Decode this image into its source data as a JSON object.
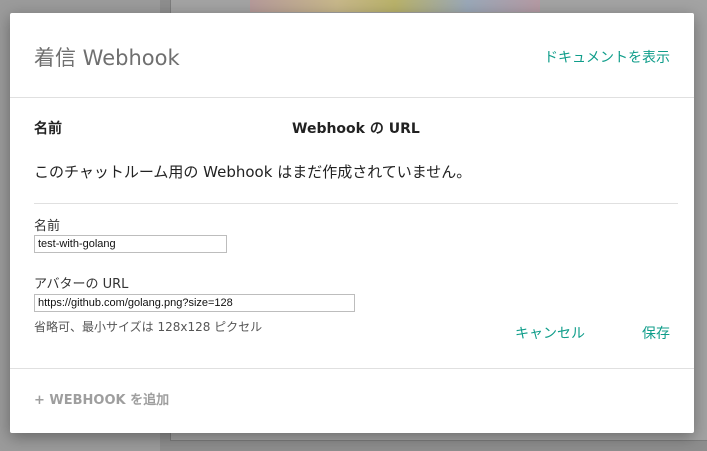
{
  "dialog": {
    "title": "着信 Webhook",
    "docs_link": "ドキュメントを表示",
    "columns": {
      "name": "名前",
      "url": "Webhook の URL"
    },
    "empty_message": "このチャットルーム用の Webhook はまだ作成されていません。",
    "form": {
      "name_label": "名前",
      "name_value": "test-with-golang",
      "avatar_label": "アバターの URL",
      "avatar_value": "https://github.com/golang.png?size=128",
      "avatar_hint": "省略可、最小サイズは 128x128 ピクセル",
      "cancel_label": "キャンセル",
      "save_label": "保存"
    },
    "add_webhook_label": "+ WEBHOOK を追加"
  },
  "colors": {
    "accent": "#0f9d8a",
    "title": "#6f6f6f",
    "disabled": "#9e9e9e"
  }
}
